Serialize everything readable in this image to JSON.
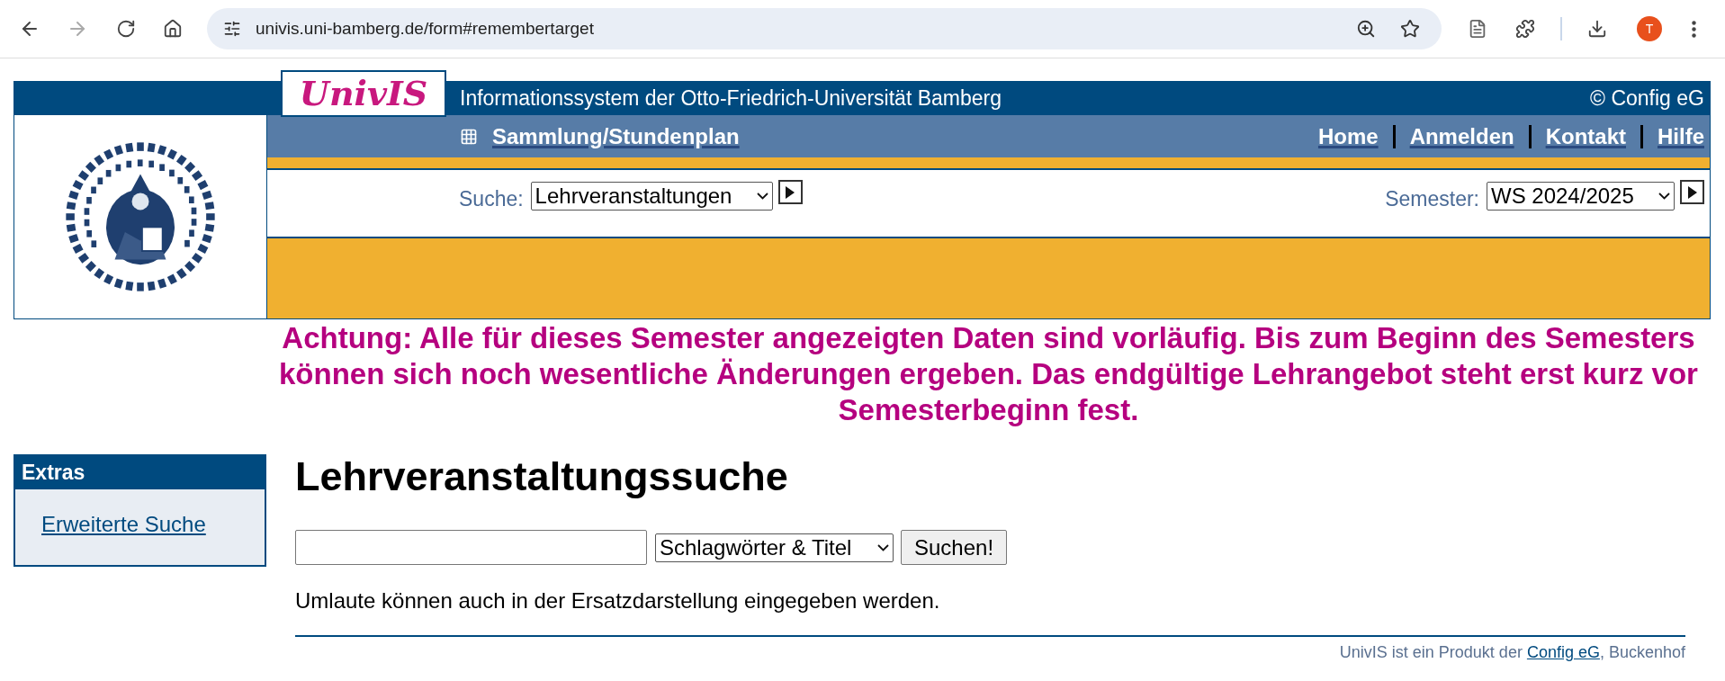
{
  "browser": {
    "url": "univis.uni-bamberg.de/form#remembertarget",
    "forward_disabled": true,
    "profile_initial": "T"
  },
  "header": {
    "logo": "UnivIS",
    "title": "Informationssystem der Otto-Friedrich-Universität Bamberg",
    "copyright": "© Config eG"
  },
  "nav": {
    "collection_link": "Sammlung/Stundenplan",
    "links": [
      "Home",
      "Anmelden",
      "Kontakt",
      "Hilfe"
    ]
  },
  "search_bar": {
    "search_label": "Suche:",
    "search_type": "Lehrveranstaltungen",
    "semester_label": "Semester:",
    "semester": "WS 2024/2025"
  },
  "warning": "Achtung: Alle für dieses Semester angezeigten Daten sind vorläufig. Bis zum Beginn des Semesters können sich noch wesentliche Änderungen ergeben. Das endgültige Lehrangebot steht erst kurz vor Semesterbeginn fest.",
  "sidebar": {
    "title": "Extras",
    "links": [
      "Erweiterte Suche"
    ]
  },
  "main": {
    "heading": "Lehrveranstaltungssuche",
    "search_scope": "Schlagwörter & Titel",
    "submit": "Suchen!",
    "hint": "Umlaute können auch in der Ersatzdarstellung eingegeben werden."
  },
  "footer": {
    "text_before": "UnivIS ist ein Produkt der ",
    "link": "Config eG",
    "text_after": ", Buckenhof"
  }
}
